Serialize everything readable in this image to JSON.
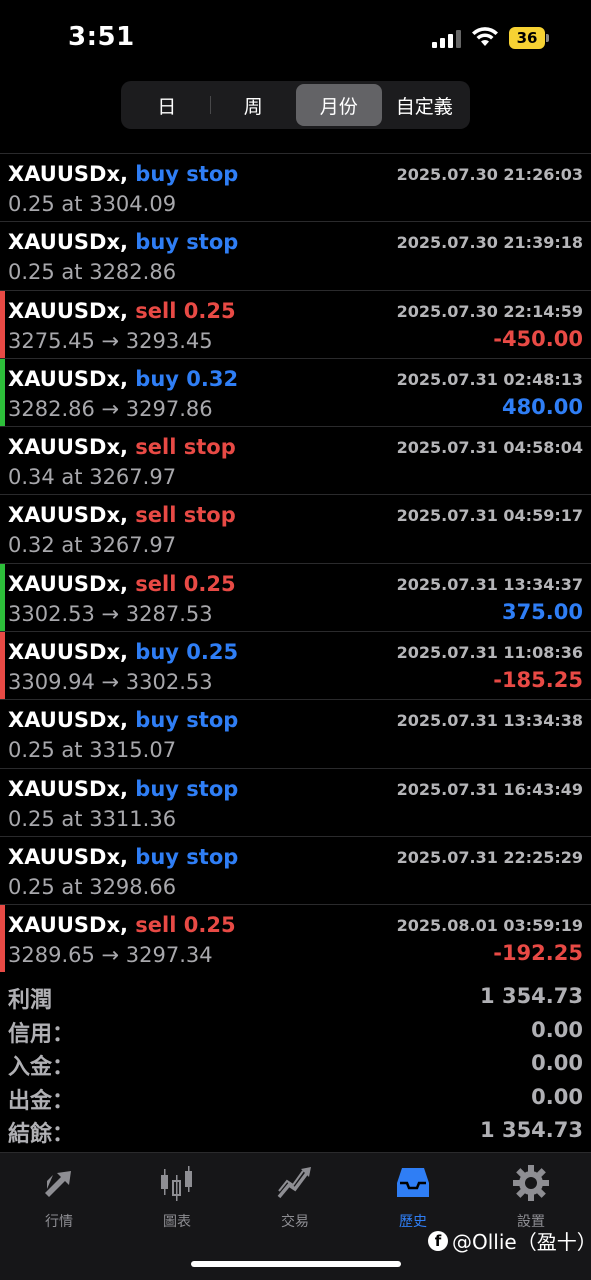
{
  "status_bar": {
    "time": "3:51",
    "battery": "36"
  },
  "segments": [
    {
      "label": "日",
      "active": false
    },
    {
      "label": "周",
      "active": false
    },
    {
      "label": "月份",
      "active": true
    },
    {
      "label": "自定義",
      "active": false
    }
  ],
  "deals": [
    {
      "symbol": "XAUUSDx,",
      "kind": "buy stop",
      "kind_color": "blue",
      "date": "2025.07.30 21:26:03",
      "detail": "0.25 at 3304.09",
      "pnl": "",
      "bar": ""
    },
    {
      "symbol": "XAUUSDx,",
      "kind": "buy stop",
      "kind_color": "blue",
      "date": "2025.07.30 21:39:18",
      "detail": "0.25 at 3282.86",
      "pnl": "",
      "bar": ""
    },
    {
      "symbol": "XAUUSDx,",
      "kind": "sell 0.25",
      "kind_color": "red",
      "date": "2025.07.30 22:14:59",
      "detail": "3275.45 → 3293.45",
      "pnl": "-450.00",
      "pnl_color": "red",
      "bar": "red"
    },
    {
      "symbol": "XAUUSDx,",
      "kind": "buy 0.32",
      "kind_color": "blue",
      "date": "2025.07.31 02:48:13",
      "detail": "3282.86 → 3297.86",
      "pnl": "480.00",
      "pnl_color": "blue",
      "bar": "green"
    },
    {
      "symbol": "XAUUSDx,",
      "kind": "sell stop",
      "kind_color": "red",
      "date": "2025.07.31 04:58:04",
      "detail": "0.34 at 3267.97",
      "pnl": "",
      "bar": ""
    },
    {
      "symbol": "XAUUSDx,",
      "kind": "sell stop",
      "kind_color": "red",
      "date": "2025.07.31 04:59:17",
      "detail": "0.32 at 3267.97",
      "pnl": "",
      "bar": ""
    },
    {
      "symbol": "XAUUSDx,",
      "kind": "sell 0.25",
      "kind_color": "red",
      "date": "2025.07.31 13:34:37",
      "detail": "3302.53 → 3287.53",
      "pnl": "375.00",
      "pnl_color": "blue",
      "bar": "green"
    },
    {
      "symbol": "XAUUSDx,",
      "kind": "buy 0.25",
      "kind_color": "blue",
      "date": "2025.07.31 11:08:36",
      "detail": "3309.94 → 3302.53",
      "pnl": "-185.25",
      "pnl_color": "red",
      "bar": "red"
    },
    {
      "symbol": "XAUUSDx,",
      "kind": "buy stop",
      "kind_color": "blue",
      "date": "2025.07.31 13:34:38",
      "detail": "0.25 at 3315.07",
      "pnl": "",
      "bar": ""
    },
    {
      "symbol": "XAUUSDx,",
      "kind": "buy stop",
      "kind_color": "blue",
      "date": "2025.07.31 16:43:49",
      "detail": "0.25 at 3311.36",
      "pnl": "",
      "bar": ""
    },
    {
      "symbol": "XAUUSDx,",
      "kind": "buy stop",
      "kind_color": "blue",
      "date": "2025.07.31 22:25:29",
      "detail": "0.25 at 3298.66",
      "pnl": "",
      "bar": ""
    },
    {
      "symbol": "XAUUSDx,",
      "kind": "sell 0.25",
      "kind_color": "red",
      "date": "2025.08.01 03:59:19",
      "detail": "3289.65 → 3297.34",
      "pnl": "-192.25",
      "pnl_color": "red",
      "bar": "red"
    }
  ],
  "summary": [
    {
      "label": "利潤",
      "value": "1 354.73"
    },
    {
      "label": "信用：",
      "value": "0.00"
    },
    {
      "label": "入金：",
      "value": "0.00"
    },
    {
      "label": "出金：",
      "value": "0.00"
    },
    {
      "label": "結餘：",
      "value": "1 354.73"
    }
  ],
  "tabs": [
    {
      "label": "行情",
      "icon": "quotes-arrows-icon",
      "active": false
    },
    {
      "label": "圖表",
      "icon": "candlestick-chart-icon",
      "active": false
    },
    {
      "label": "交易",
      "icon": "trade-chart-icon",
      "active": false
    },
    {
      "label": "歷史",
      "icon": "history-inbox-icon",
      "active": true
    },
    {
      "label": "設置",
      "icon": "gear-icon",
      "active": false
    }
  ],
  "watermark": {
    "text": "@Ollie（盈十）",
    "icon": "facebook-icon",
    "icon_text": "f"
  },
  "colors": {
    "blue": "#2f7ef5",
    "red": "#e84a45",
    "green": "#2dbf3a"
  }
}
